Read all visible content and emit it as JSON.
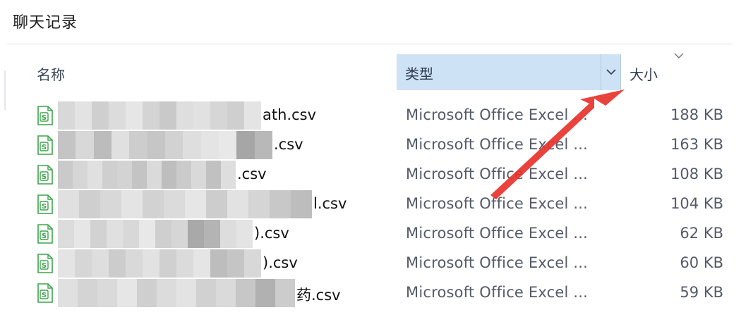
{
  "window": {
    "title": "聊天记录"
  },
  "columns": {
    "name": "名称",
    "type": "类型",
    "size": "大小"
  },
  "rows": [
    {
      "name_suffix": "ath.csv",
      "type": "Microsoft Office Excel ...",
      "size": "188 KB"
    },
    {
      "name_suffix": ".csv",
      "type": "Microsoft Office Excel ...",
      "size": "163 KB"
    },
    {
      "name_suffix": ".csv",
      "type": "Microsoft Office Excel ...",
      "size": "108 KB"
    },
    {
      "name_suffix": "l.csv",
      "type": "Microsoft Office Excel ...",
      "size": "104 KB"
    },
    {
      "name_suffix": ").csv",
      "type": "Microsoft Office Excel ...",
      "size": "62 KB"
    },
    {
      "name_suffix": ").csv",
      "type": "Microsoft Office Excel ...",
      "size": "60 KB"
    },
    {
      "name_suffix": "药.csv",
      "type": "Microsoft Office Excel ...",
      "size": "59 KB"
    }
  ],
  "colors": {
    "header_highlight": "#cde3f5",
    "annotation_arrow": "#e8322b",
    "file_icon": "#3fa34d"
  },
  "icons": {
    "file": "excel-csv-file-icon",
    "column_dropdown": "chevron-down-icon",
    "sort": "sort-caret-icon"
  }
}
